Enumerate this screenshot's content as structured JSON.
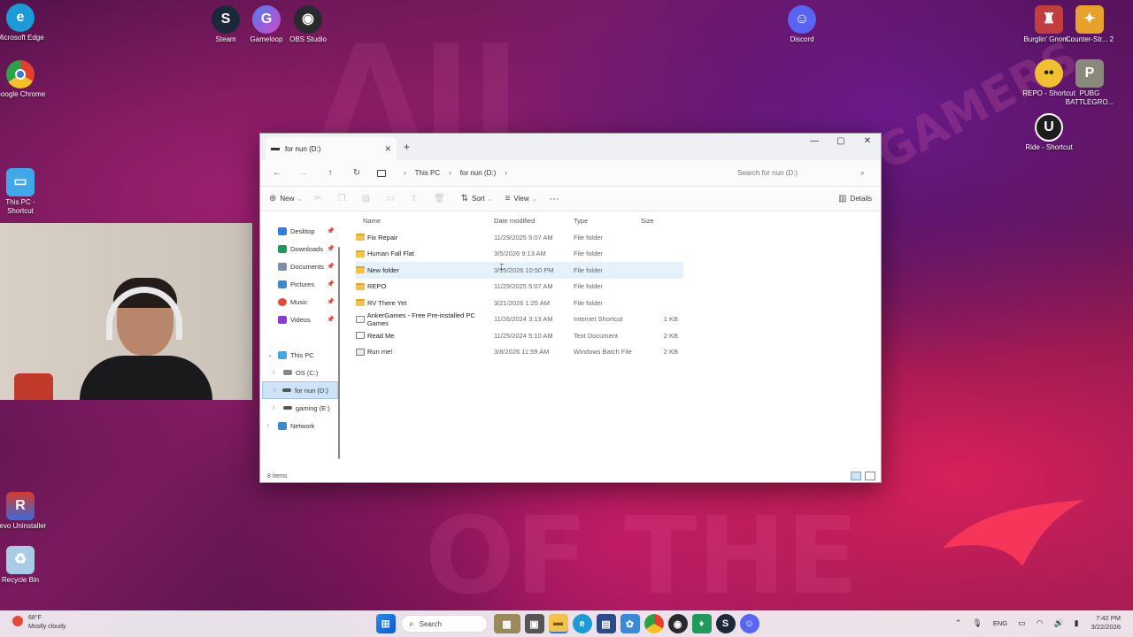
{
  "desktop": {
    "icons": [
      {
        "label": "Microsoft Edge",
        "icon": "edge-icon",
        "color": "#1a9ad6"
      },
      {
        "label": "Google Chrome",
        "icon": "chrome-icon",
        "color": "#e0412f"
      },
      {
        "label": "This PC - Shortcut",
        "icon": "this-pc-icon",
        "color": "#3fa8e8"
      },
      {
        "label": "Revo Uninstaller",
        "icon": "revo-uninstaller-icon",
        "color": "#d33b2c"
      },
      {
        "label": "Recycle Bin",
        "icon": "recycle-bin-icon",
        "color": "#7fb6e0"
      },
      {
        "label": "Steam",
        "icon": "steam-icon",
        "color": "#1b2838"
      },
      {
        "label": "Gameloop",
        "icon": "gameloop-icon",
        "color": "#4f7cf0"
      },
      {
        "label": "OBS Studio",
        "icon": "obs-icon",
        "color": "#2a2a2e"
      },
      {
        "label": "Discord",
        "icon": "discord-icon",
        "color": "#5865f2"
      },
      {
        "label": "Burglin' Gnom...",
        "icon": "burglin-gnomes-icon",
        "color": "#c23d3d"
      },
      {
        "label": "Counter-Str... 2",
        "icon": "counter-strike-icon",
        "color": "#e8a22a"
      },
      {
        "label": "REPO - Shortcut",
        "icon": "repo-icon",
        "color": "#f0c030"
      },
      {
        "label": "PUBG BATTLEGRO...",
        "icon": "pubg-icon",
        "color": "#8a8a7a"
      },
      {
        "label": "Ride - Shortcut",
        "icon": "unreal-icon",
        "color": "#1d1d1d"
      }
    ]
  },
  "explorer": {
    "tab_title": "for nun (D:)",
    "breadcrumb": [
      "This PC",
      "for nun (D:)"
    ],
    "search_placeholder": "Search for nun (D:)",
    "commands": {
      "new": "New",
      "sort": "Sort",
      "view": "View",
      "more": "···",
      "details": "Details"
    },
    "nav": {
      "quick": [
        {
          "label": "Desktop",
          "color": "#2a7de1"
        },
        {
          "label": "Downloads",
          "color": "#1f9a5a"
        },
        {
          "label": "Documents",
          "color": "#7a8ea8"
        },
        {
          "label": "Pictures",
          "color": "#3a8ad8"
        },
        {
          "label": "Music",
          "color": "#e04a3a"
        },
        {
          "label": "Videos",
          "color": "#8a3ad8"
        }
      ],
      "this_pc": "This PC",
      "drives": [
        "OS (C:)",
        "for nun (D:)",
        "gaming (E:)"
      ],
      "network": "Network"
    },
    "columns": {
      "name": "Name",
      "date": "Date modified",
      "type": "Type",
      "size": "Size"
    },
    "files": [
      {
        "name": "Fix Repair",
        "date": "11/29/2025 5:07 AM",
        "type": "File folder",
        "size": "",
        "kind": "folder"
      },
      {
        "name": "Human Fall Flat",
        "date": "3/5/2026 9:13 AM",
        "type": "File folder",
        "size": "",
        "kind": "folder"
      },
      {
        "name": "New folder",
        "date": "3/15/2026 10:50 PM",
        "type": "File folder",
        "size": "",
        "kind": "folder"
      },
      {
        "name": "REPO",
        "date": "11/29/2025 5:07 AM",
        "type": "File folder",
        "size": "",
        "kind": "folder"
      },
      {
        "name": "RV There Yet",
        "date": "3/21/2026 1:25 AM",
        "type": "File folder",
        "size": "",
        "kind": "folder"
      },
      {
        "name": "AnkerGames - Free Pre-installed PC Games",
        "date": "11/26/2024 3:13 AM",
        "type": "Internet Shortcut",
        "size": "1 KB",
        "kind": "web"
      },
      {
        "name": "Read Me",
        "date": "11/25/2024 5:10 AM",
        "type": "Text Document",
        "size": "2 KB",
        "kind": "doc"
      },
      {
        "name": "Run me!",
        "date": "3/8/2026 11:59 AM",
        "type": "Windows Batch File",
        "size": "2 KB",
        "kind": "bat"
      }
    ],
    "status": "8 items"
  },
  "taskbar": {
    "weather_temp": "68°F",
    "weather_desc": "Mostly cloudy",
    "search": "Search",
    "lang": "ENG",
    "time": "7:42 PM",
    "date": "3/22/2026"
  }
}
